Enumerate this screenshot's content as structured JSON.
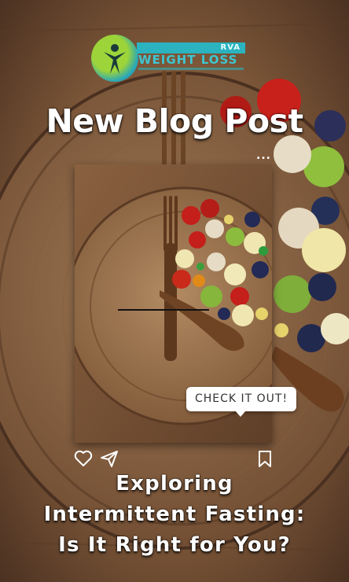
{
  "brand": {
    "logo_top_text": "RVA",
    "logo_main_text": "WEIGHT LOSS",
    "colors": {
      "teal": "#2bb3c0",
      "green": "#9cd43a"
    }
  },
  "headline": "New Blog Post",
  "more_dots": "...",
  "post": {
    "cta_label": "CHECK IT OUT!",
    "actions": [
      "heart-icon",
      "send-icon",
      "bookmark-icon"
    ]
  },
  "caption": {
    "line1": "Exploring",
    "line2": "Intermittent Fasting:",
    "line3": "Is It Right for You?"
  }
}
